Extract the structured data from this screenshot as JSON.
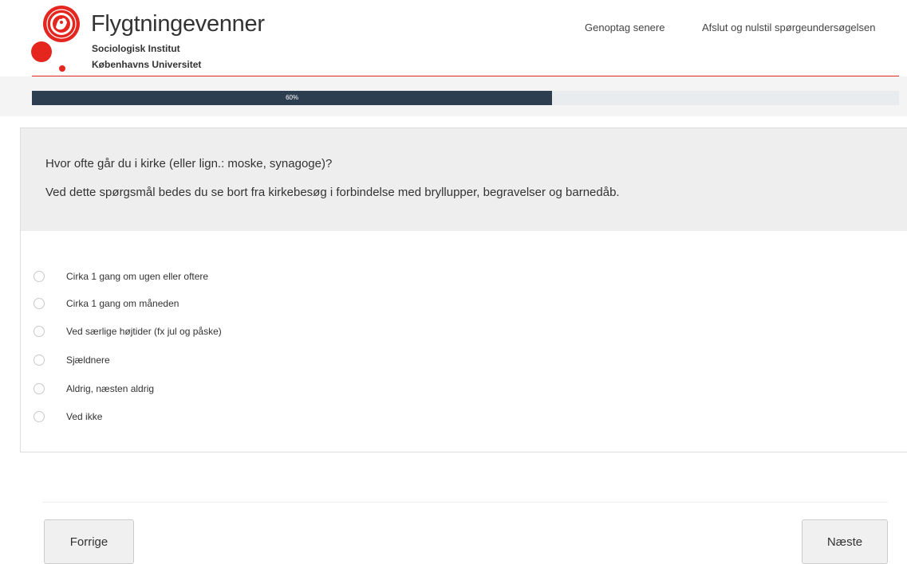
{
  "header": {
    "title": "Flygtningevenner",
    "subtitle_line1": "Sociologisk Institut",
    "subtitle_line2": "Københavns Universitet",
    "nav": {
      "resume_label": "Genoptag senere",
      "exit_label": "Afslut og nulstil spørgeundersøgelsen"
    },
    "brand_color": "#e5261f"
  },
  "progress": {
    "percent": 60,
    "label": "60%",
    "fill_color": "#2c3e50"
  },
  "question": {
    "text": "Hvor ofte går du i kirke (eller lign.: moske, synagoge)?",
    "help": "Ved dette spørgsmål bedes du se bort fra kirkebesøg i forbindelse med bryllupper, begravelser og barnedåb.",
    "options": [
      "Cirka 1 gang om ugen eller oftere",
      "Cirka 1 gang om måneden",
      "Ved særlige højtider (fx jul og påske)",
      "Sjældnere",
      "Aldrig, næsten aldrig",
      "Ved ikke"
    ]
  },
  "footer": {
    "prev_label": "Forrige",
    "next_label": "Næste"
  }
}
